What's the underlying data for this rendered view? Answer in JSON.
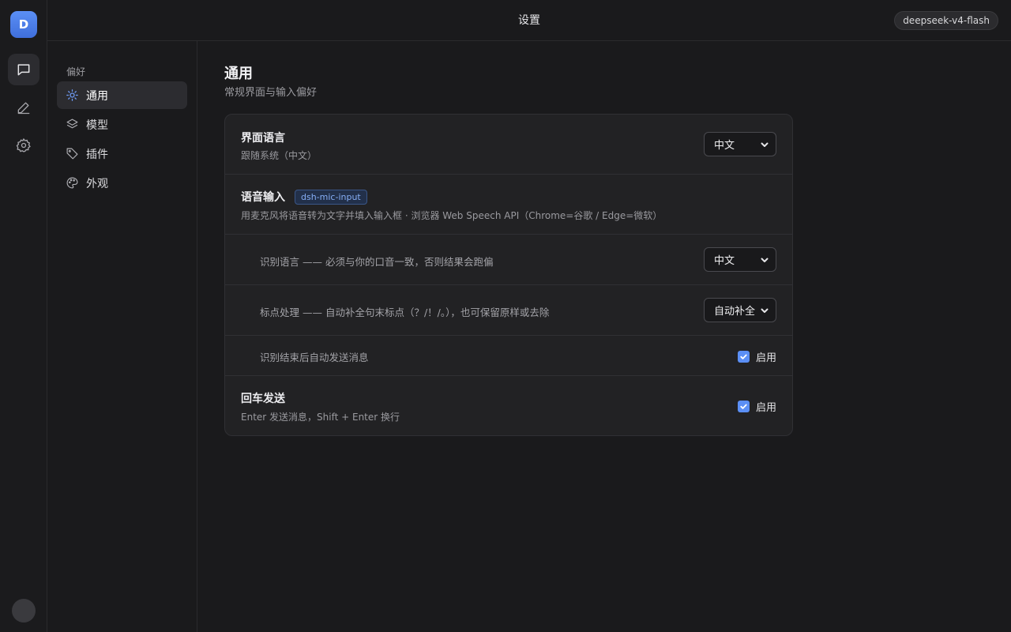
{
  "rail": {
    "logo_letter": "D",
    "items": [
      {
        "icon": "chat-icon",
        "active": true
      },
      {
        "icon": "pen-icon",
        "active": false
      },
      {
        "icon": "gear-icon",
        "active": false
      }
    ]
  },
  "topbar": {
    "title": "设置",
    "model": "deepseek-v4-flash"
  },
  "nav": {
    "group_label": "偏好",
    "items": [
      {
        "label": "通用",
        "icon": "sun-icon",
        "active": true
      },
      {
        "label": "模型",
        "icon": "layers-icon",
        "active": false
      },
      {
        "label": "插件",
        "icon": "tag-icon",
        "active": false
      },
      {
        "label": "外观",
        "icon": "palette-icon",
        "active": false
      }
    ]
  },
  "main": {
    "title": "通用",
    "subtitle": "常规界面与输入偏好",
    "accent_color": "#5b8ff5",
    "ui_language": {
      "title": "界面语言",
      "desc": "跟随系统（中文）",
      "value": "中文"
    },
    "voice_input": {
      "title": "语音输入",
      "tag": "dsh-mic-input",
      "desc": "用麦克风将语音转为文字并填入输入框 · 浏览器 Web Speech API（Chrome=谷歌 / Edge=微软）"
    },
    "recog_language": {
      "label": "识别语言 —— 必须与你的口音一致，否则结果会跑偏",
      "value": "中文"
    },
    "punctuation": {
      "label": "标点处理 —— 自动补全句末标点（？/！/。），也可保留原样或去除",
      "value": "自动补全"
    },
    "auto_send": {
      "label": "识别结束后自动发送消息",
      "checkbox_label": "启用",
      "checked": true
    },
    "enter_send": {
      "title": "回车发送",
      "desc": "Enter 发送消息，Shift + Enter 换行",
      "checkbox_label": "启用",
      "checked": true
    }
  }
}
